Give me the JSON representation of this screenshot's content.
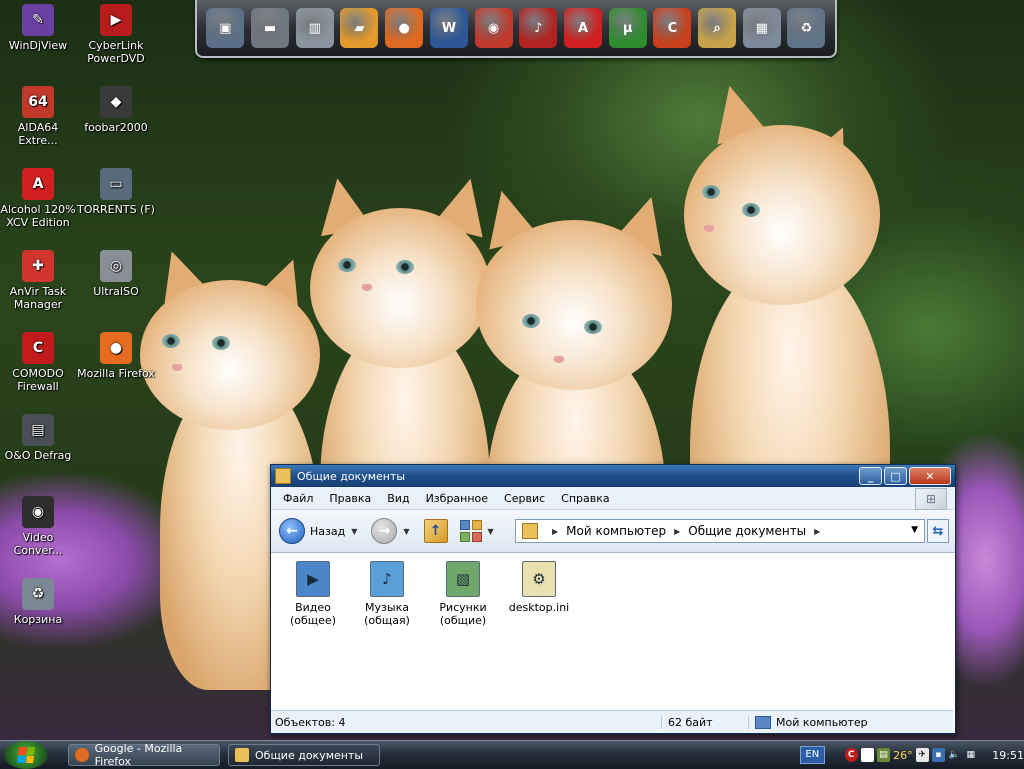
{
  "desktop_icons": [
    {
      "label": "WinDjView",
      "icon": "windjview-icon",
      "glyph": "✎",
      "color": "#6b3fa0"
    },
    {
      "label": "CyberLink PowerDVD",
      "icon": "powerdvd-icon",
      "glyph": "▶",
      "color": "#b81c1c"
    },
    {
      "label": "AIDA64 Extre...",
      "icon": "aida64-icon",
      "glyph": "64",
      "color": "#c0392b"
    },
    {
      "label": "foobar2000",
      "icon": "foobar2000-icon",
      "glyph": "◆",
      "color": "#3a3a3a"
    },
    {
      "label": "Alcohol 120% XCV Edition",
      "icon": "alcohol-icon",
      "glyph": "A",
      "color": "#d21f1f"
    },
    {
      "label": "TORRENTS (F)",
      "icon": "drive-icon",
      "glyph": "▭",
      "color": "#5a6b7c"
    },
    {
      "label": "AnVir Task Manager",
      "icon": "anvir-icon",
      "glyph": "✚",
      "color": "#d0342c"
    },
    {
      "label": "UltraISO",
      "icon": "ultraiso-icon",
      "glyph": "◎",
      "color": "#8a8f96"
    },
    {
      "label": "COMODO Firewall",
      "icon": "comodo-icon",
      "glyph": "C",
      "color": "#c21b1b"
    },
    {
      "label": "Mozilla Firefox",
      "icon": "firefox-icon",
      "glyph": "●",
      "color": "#e66a1f"
    },
    {
      "label": "O&O Defrag",
      "icon": "defrag-icon",
      "glyph": "▤",
      "color": "#4a4f55"
    },
    {
      "label": "Video Conver...",
      "icon": "video-converter-icon",
      "glyph": "◉",
      "color": "#2e2e2e"
    },
    {
      "label": "Корзина",
      "icon": "recycle-bin-icon",
      "glyph": "♻",
      "color": "#7b8794"
    }
  ],
  "dock_items": [
    {
      "icon": "my-computer-icon",
      "glyph": "▣",
      "color": "#5b6f86"
    },
    {
      "icon": "hard-drive-icon",
      "glyph": "▬",
      "color": "#6e7680"
    },
    {
      "icon": "removable-drive-icon",
      "glyph": "▥",
      "color": "#8b949e"
    },
    {
      "icon": "folder-icon",
      "glyph": "▰",
      "color": "#e49a2a"
    },
    {
      "icon": "firefox-icon",
      "glyph": "●",
      "color": "#e06a1f"
    },
    {
      "icon": "word-icon",
      "glyph": "W",
      "color": "#2b5797"
    },
    {
      "icon": "burning-disc-icon",
      "glyph": "◉",
      "color": "#c0392b"
    },
    {
      "icon": "audio-editor-icon",
      "glyph": "♪",
      "color": "#b22222"
    },
    {
      "icon": "alcohol-icon",
      "glyph": "A",
      "color": "#d21f1f"
    },
    {
      "icon": "utorrent-icon",
      "glyph": "µ",
      "color": "#2e8b2e"
    },
    {
      "icon": "ccleaner-icon",
      "glyph": "C",
      "color": "#c8401c"
    },
    {
      "icon": "search-icon",
      "glyph": "⌕",
      "color": "#c9a34a"
    },
    {
      "icon": "control-panel-icon",
      "glyph": "▦",
      "color": "#7e8a99"
    },
    {
      "icon": "recycle-bin-icon",
      "glyph": "♻",
      "color": "#5f7489"
    }
  ],
  "window": {
    "title": "Общие документы",
    "menu": [
      "Файл",
      "Правка",
      "Вид",
      "Избранное",
      "Сервис",
      "Справка"
    ],
    "back_label": "Назад",
    "breadcrumbs": [
      "Мой компьютер",
      "Общие документы"
    ],
    "files": [
      {
        "label": "Видео (общее)",
        "icon": "video-folder-icon",
        "glyph": "▶",
        "color": "#4b86c9"
      },
      {
        "label": "Музыка (общая)",
        "icon": "music-folder-icon",
        "glyph": "♪",
        "color": "#5aa0d8"
      },
      {
        "label": "Рисунки (общие)",
        "icon": "pictures-folder-icon",
        "glyph": "▧",
        "color": "#6fa86a"
      },
      {
        "label": "desktop.ini",
        "icon": "ini-file-icon",
        "glyph": "⚙",
        "color": "#e8e2b0"
      }
    ],
    "status": {
      "count": "Объектов: 4",
      "size": "62 байт",
      "location": "Мой компьютер"
    }
  },
  "taskbar": {
    "buttons": [
      {
        "label": "Google - Mozilla Firefox",
        "color": "#e06a1f"
      },
      {
        "label": "Общие документы",
        "color": "#e9c05a"
      }
    ],
    "language": "EN",
    "temperature": "26°",
    "clock": "19:51"
  }
}
